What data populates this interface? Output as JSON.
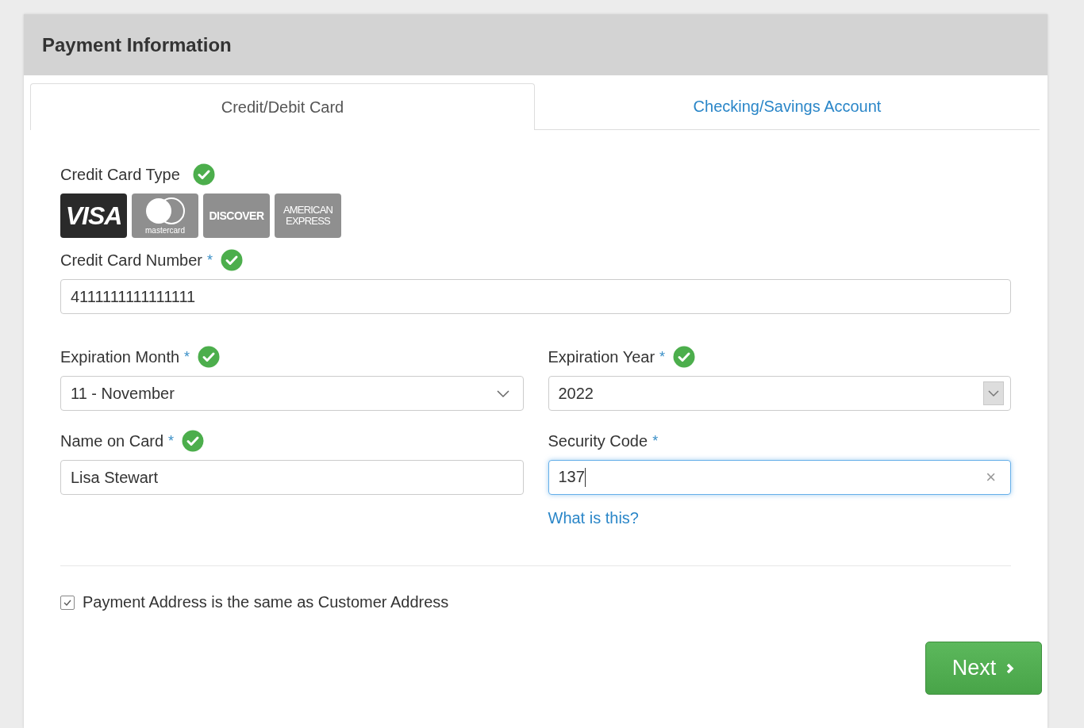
{
  "panel": {
    "title": "Payment Information"
  },
  "tabs": [
    {
      "label": "Credit/Debit Card",
      "selected": true
    },
    {
      "label": "Checking/Savings Account",
      "selected": false
    }
  ],
  "card_type": {
    "label": "Credit Card Type",
    "validated": true,
    "cards": [
      {
        "kind": "visa",
        "label": "VISA",
        "selected": true
      },
      {
        "kind": "mastercard",
        "label": "mastercard",
        "selected": false
      },
      {
        "kind": "discover",
        "label": "DISCOVER",
        "selected": false
      },
      {
        "kind": "amex",
        "label": "AMERICAN EXPRESS",
        "selected": false
      }
    ]
  },
  "fields": [
    {
      "kind": "text",
      "label": "Credit Card Number",
      "required": "*",
      "validated": true,
      "value": "4111111111111111",
      "wide": true,
      "focused": false
    },
    {
      "kind": "select",
      "label": "Expiration Month",
      "required": "*",
      "validated": true,
      "value": "11 - November",
      "wide": false,
      "boxed_arrow": false
    },
    {
      "kind": "select",
      "label": "Expiration Year",
      "required": "*",
      "validated": true,
      "value": "2022",
      "wide": false,
      "boxed_arrow": true
    },
    {
      "kind": "text",
      "label": "Name on Card",
      "required": "*",
      "validated": true,
      "value": "Lisa Stewart",
      "wide": false,
      "focused": false
    },
    {
      "kind": "text",
      "label": "Security Code",
      "required": "*",
      "validated": false,
      "value": "137",
      "wide": false,
      "focused": true,
      "clear": "×",
      "help_link": "What is this?"
    }
  ],
  "same_address": {
    "label": "Payment Address is the same as Customer Address",
    "checked": true
  },
  "next_button": {
    "label": "Next"
  }
}
